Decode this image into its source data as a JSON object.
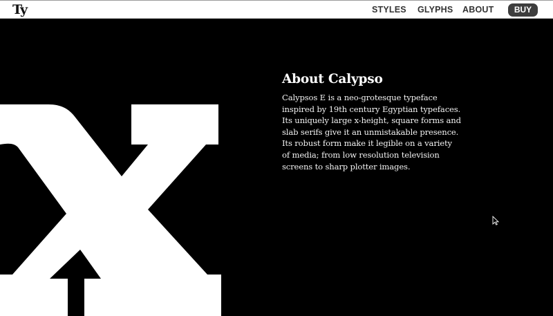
{
  "header": {
    "logo": "Ty",
    "nav": [
      {
        "label": "STYLES"
      },
      {
        "label": "GLYPHS"
      },
      {
        "label": "ABOUT"
      }
    ],
    "buy_label": "BUY"
  },
  "hero": {
    "glyph": "x",
    "glyph_color": "#ffffff",
    "background": "#000000"
  },
  "about": {
    "title": "About Calypso",
    "body": "Calypsos E is a neo-grotesque typeface inspired by 19th century Egyptian typefaces. Its uniquely large x-height, square forms and slab serifs give it an unmistakable presence. Its robust form make it legible on a variety of media; from low resolution television screens to sharp plotter images."
  },
  "icons": {
    "cursor": "mouse-pointer-icon"
  }
}
